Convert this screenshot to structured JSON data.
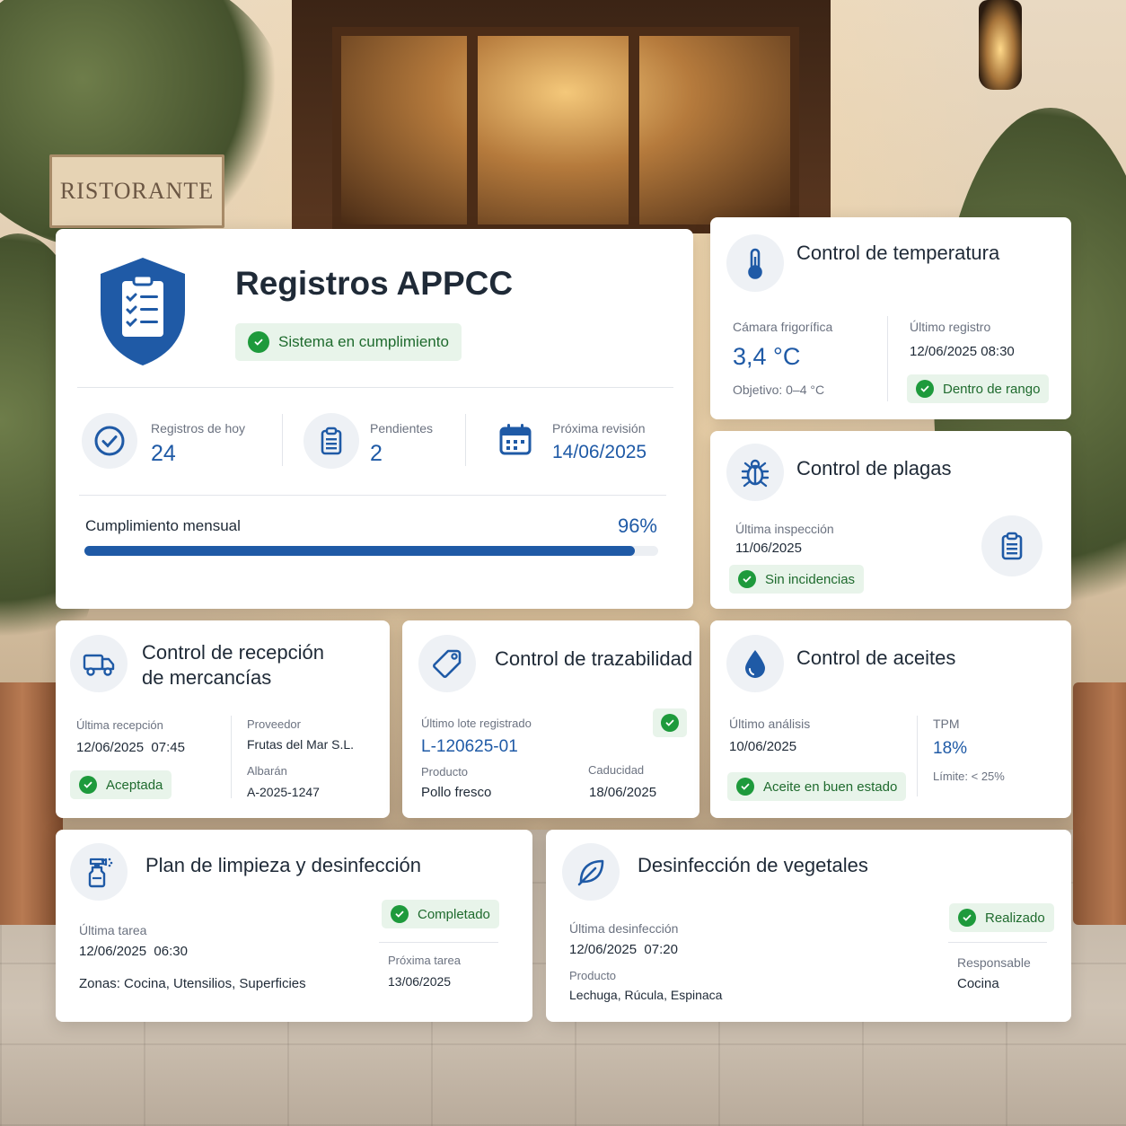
{
  "background": {
    "sign_text": "RISTORANTE"
  },
  "colors": {
    "primary_blue": "#1f5aa6",
    "success_green": "#1e9a3c",
    "badge_bg": "#e8f4ea"
  },
  "main": {
    "title": "Registros APPCC",
    "status": "Sistema en cumplimiento",
    "stats": [
      {
        "label": "Registros de hoy",
        "value": "24",
        "icon": "check-circle-icon"
      },
      {
        "label": "Pendientes",
        "value": "2",
        "icon": "clipboard-icon"
      },
      {
        "label": "Próxima revisión",
        "value": "14/06/2025",
        "icon": "calendar-icon"
      }
    ],
    "compliance_label": "Cumplimiento mensual",
    "compliance_value": "96%",
    "compliance_fraction": 0.96
  },
  "temperature": {
    "title": "Control de temperatura",
    "chamber_label": "Cámara frigorífica",
    "chamber_value": "3,4 °C",
    "target": "Objetivo: 0–4 °C",
    "last_label": "Último registro",
    "last_value": "12/06/2025 08:30",
    "status": "Dentro de rango"
  },
  "pests": {
    "title": "Control de plagas",
    "last_label": "Última inspección",
    "last_value": "11/06/2025",
    "status": "Sin incidencias"
  },
  "reception": {
    "title_line1": "Control de recepción",
    "title_line2": "de mercancías",
    "last_label": "Última recepción",
    "last_value": "12/06/2025  07:45",
    "status": "Aceptada",
    "supplier_label": "Proveedor",
    "supplier_value": "Frutas del Mar S.L.",
    "delivery_label": "Albarán",
    "delivery_value": "A-2025-1247"
  },
  "traceability": {
    "title": "Control de trazabilidad",
    "lot_label": "Último lote registrado",
    "lot_value": "L-120625-01",
    "product_label": "Producto",
    "product_value": "Pollo fresco",
    "expiry_label": "Caducidad",
    "expiry_value": "18/06/2025"
  },
  "oils": {
    "title": "Control de aceites",
    "last_label": "Último análisis",
    "last_value": "10/06/2025",
    "status": "Aceite en buen estado",
    "tpm_label": "TPM",
    "tpm_value": "18%",
    "limit": "Límite: < 25%"
  },
  "cleaning": {
    "title": "Plan de limpieza y desinfección",
    "status": "Completado",
    "last_label": "Última tarea",
    "last_value": "12/06/2025  06:30",
    "zones": "Zonas: Cocina, Utensilios, Superficies",
    "next_label": "Próxima tarea",
    "next_value": "13/06/2025"
  },
  "vegetables": {
    "title": "Desinfección de vegetales",
    "status": "Realizado",
    "last_label": "Última desinfección",
    "last_value": "12/06/2025  07:20",
    "product_label": "Producto",
    "product_value": "Lechuga, Rúcula, Espinaca",
    "responsible_label": "Responsable",
    "responsible_value": "Cocina"
  }
}
